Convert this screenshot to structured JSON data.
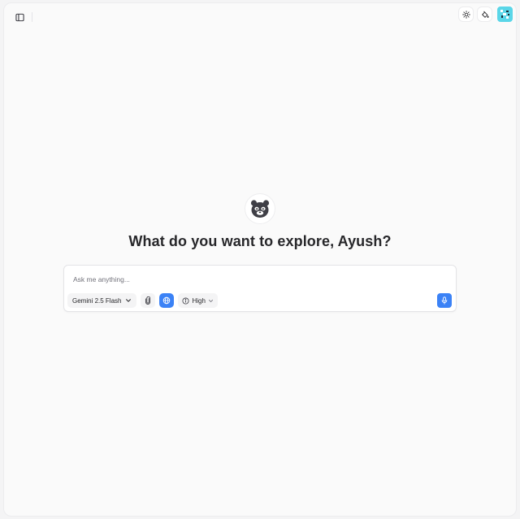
{
  "header": {
    "sidebar_toggle_icon": "sidebar-panel-icon",
    "theme_toggle_icon": "sun-icon",
    "customize_icon": "paint-bucket-icon",
    "avatar_color": "#5ad6e8"
  },
  "hero": {
    "logo_icon": "bear-logo-icon",
    "greeting": "What do you want to explore, Ayush?"
  },
  "composer": {
    "placeholder": "Ask me anything...",
    "value": "",
    "model_label": "Gemini 2.5 Flash",
    "attach_icon": "paperclip-icon",
    "web_search_icon": "globe-icon",
    "web_search_active": true,
    "reasoning_label": "High",
    "mic_icon": "mic-icon"
  },
  "colors": {
    "accent": "#3b82f6",
    "background": "#fafafa",
    "text": "#27272a"
  }
}
